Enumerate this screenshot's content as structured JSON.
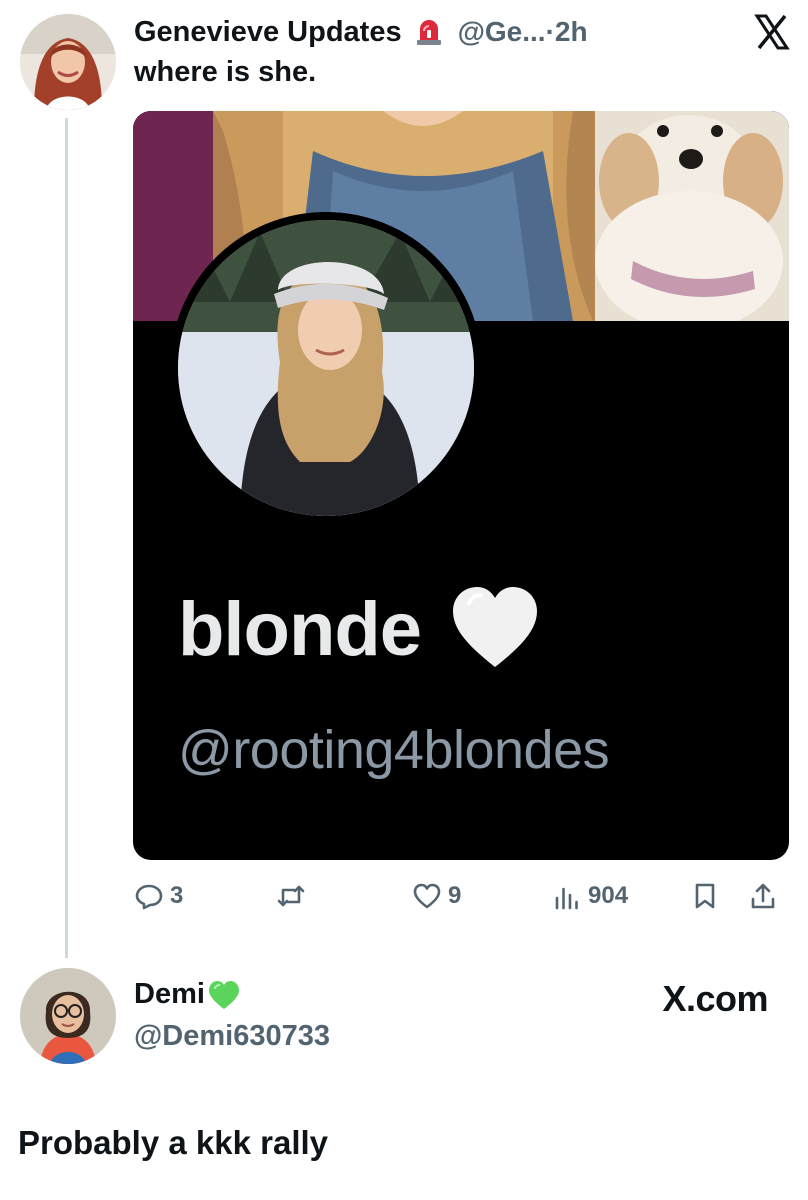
{
  "post": {
    "display_name": "Genevieve Updates",
    "badge_icon": "siren-icon",
    "handle_time": "@Ge...·2h",
    "text": "where is she.",
    "embed": {
      "name": "blonde",
      "name_icon": "white-heart-icon",
      "handle": "@rooting4blondes"
    },
    "actions": {
      "replies": "3",
      "likes": "9",
      "views": "904"
    }
  },
  "reply": {
    "display_name": "Demi",
    "name_icon": "green-heart-icon",
    "handle": "@Demi630733",
    "watermark": "X.com",
    "text": "Probably a kkk rally"
  },
  "colors": {
    "text_primary": "#0f1419",
    "text_secondary": "#536471",
    "thread_line": "#cfd9de",
    "embed_background": "#000000",
    "green_heart": "#5bd45b"
  }
}
